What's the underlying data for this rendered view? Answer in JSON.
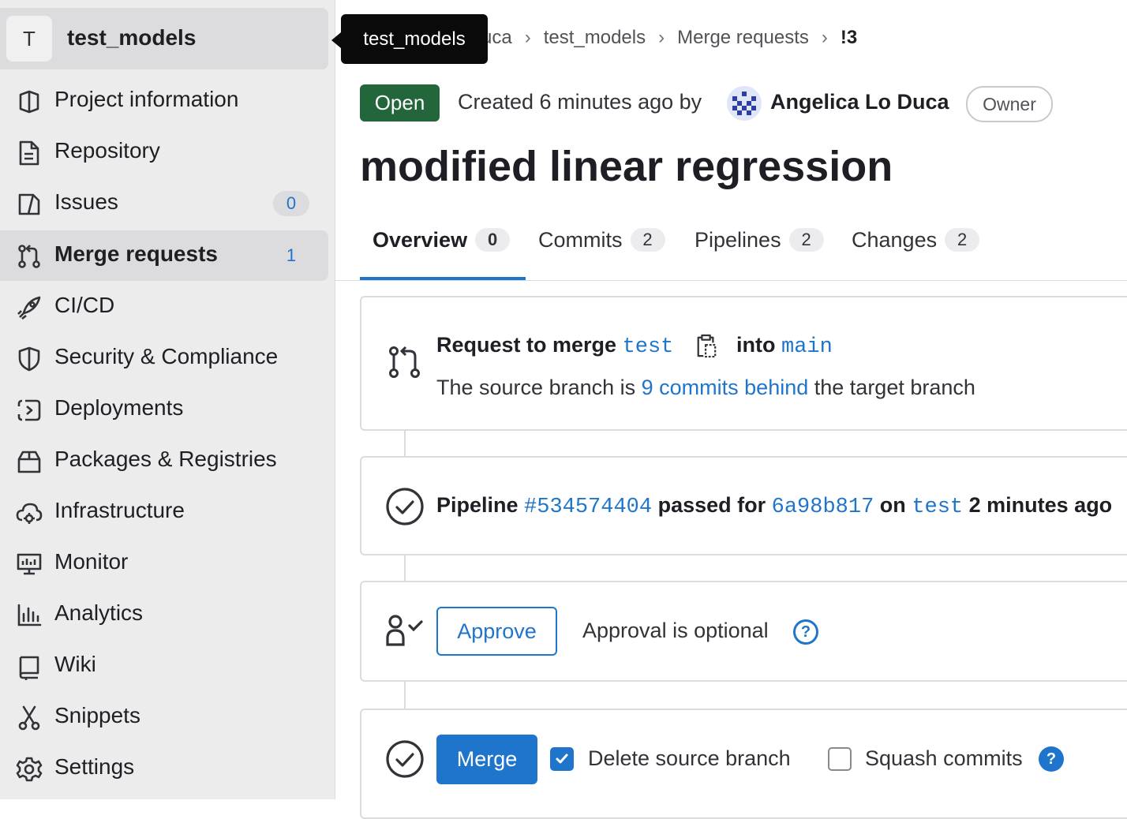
{
  "project": {
    "avatar_letter": "T",
    "name": "test_models"
  },
  "tooltip": {
    "text": "test_models"
  },
  "sidebar": {
    "items": [
      {
        "label": "Project information",
        "icon": "project-icon"
      },
      {
        "label": "Repository",
        "icon": "doc-icon"
      },
      {
        "label": "Issues",
        "icon": "issues-icon",
        "badge": "0"
      },
      {
        "label": "Merge requests",
        "icon": "merge-request-icon",
        "badge": "1",
        "active": true
      },
      {
        "label": "CI/CD",
        "icon": "rocket-icon"
      },
      {
        "label": "Security & Compliance",
        "icon": "shield-icon"
      },
      {
        "label": "Deployments",
        "icon": "deployments-icon"
      },
      {
        "label": "Packages & Registries",
        "icon": "package-icon"
      },
      {
        "label": "Infrastructure",
        "icon": "cloud-gear-icon"
      },
      {
        "label": "Monitor",
        "icon": "monitor-icon"
      },
      {
        "label": "Analytics",
        "icon": "chart-icon"
      },
      {
        "label": "Wiki",
        "icon": "book-icon"
      },
      {
        "label": "Snippets",
        "icon": "scissors-icon"
      },
      {
        "label": "Settings",
        "icon": "gear-icon"
      }
    ]
  },
  "breadcrumb": {
    "item1": "uca",
    "item2": "test_models",
    "item3": "Merge requests",
    "current": "!3"
  },
  "header": {
    "status": "Open",
    "created": "Created 6 minutes ago by",
    "author": "Angelica Lo Duca",
    "role": "Owner",
    "title": "modified linear regression"
  },
  "tabs": [
    {
      "label": "Overview",
      "count": "0",
      "active": true
    },
    {
      "label": "Commits",
      "count": "2"
    },
    {
      "label": "Pipelines",
      "count": "2"
    },
    {
      "label": "Changes",
      "count": "2"
    }
  ],
  "merge_info": {
    "request_to_merge": "Request to merge",
    "source_branch": "test",
    "into": "into",
    "target_branch": "main",
    "behind_prefix": "The source branch is",
    "behind_link": "9 commits behind",
    "behind_suffix": "the target branch"
  },
  "pipeline": {
    "prefix": "Pipeline",
    "id": "#534574404",
    "passed_for": "passed for",
    "commit": "6a98b817",
    "on": "on",
    "branch": "test",
    "time": "2 minutes ago"
  },
  "approval": {
    "button": "Approve",
    "text": "Approval is optional"
  },
  "merge": {
    "button": "Merge",
    "delete_source_label": "Delete source branch",
    "delete_source_checked": true,
    "squash_label": "Squash commits",
    "squash_checked": false
  },
  "colors": {
    "accent": "#1f75cb",
    "open_badge": "#24663b",
    "sidebar_bg": "#ececec"
  }
}
